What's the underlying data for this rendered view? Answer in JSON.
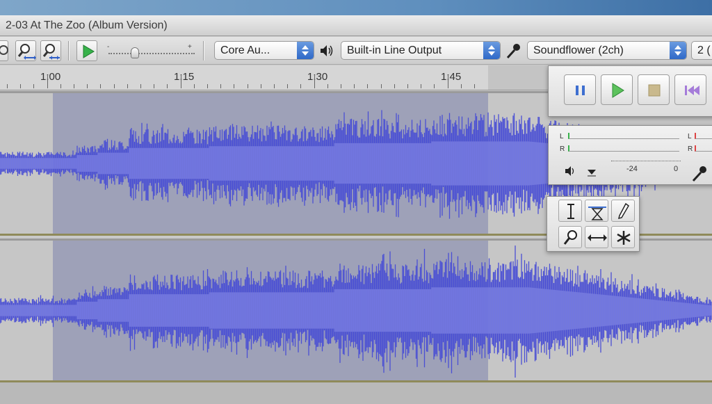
{
  "window": {
    "title": "2-03 At The Zoo (Album Version)"
  },
  "device_bar": {
    "host": "Core Au...",
    "playback_device": "Built-in Line Output",
    "recording_device": "Soundflower (2ch)",
    "channels": "2 ("
  },
  "speed_slider": {
    "min_label": "-",
    "max_label": "+"
  },
  "ruler": {
    "labels": [
      "1:00",
      "1:15",
      "1:30",
      "1:45"
    ]
  },
  "meter": {
    "left_channel": "L",
    "right_channel": "R",
    "scale_low": "-24",
    "scale_zero": "0"
  },
  "colors": {
    "waveform": "#4a4fd4",
    "waveform_light": "#7176e0",
    "selection": "#9ea1b8",
    "play_green": "#37b24a"
  },
  "icons": {
    "zoom_in": "zoom-in-icon",
    "zoom_out": "zoom-out-icon",
    "play": "play-icon",
    "speaker": "speaker-icon",
    "microphone": "microphone-icon",
    "pause": "pause-icon",
    "stop": "stop-icon",
    "skip_start": "skip-start-icon",
    "selection_tool": "selection-tool-icon",
    "envelope_tool": "envelope-tool-icon",
    "draw_tool": "draw-tool-icon",
    "zoom_tool": "zoom-tool-icon",
    "timeshift_tool": "timeshift-tool-icon",
    "multi_tool": "multi-tool-icon"
  }
}
